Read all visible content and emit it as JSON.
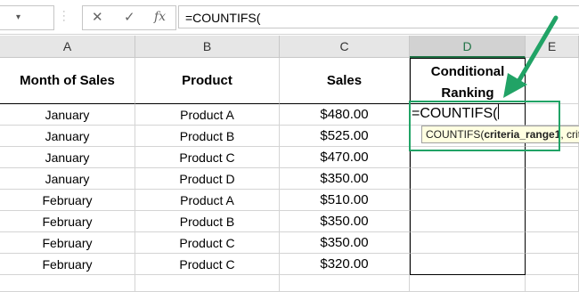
{
  "formula_bar": {
    "namebox_dropdown": "▾",
    "dots": "⋮",
    "cancel": "✕",
    "enter": "✓",
    "fx": "fx",
    "formula": "=COUNTIFS("
  },
  "columns": [
    "A",
    "B",
    "C",
    "D",
    "E"
  ],
  "header_row": {
    "month": "Month of Sales",
    "product": "Product",
    "sales": "Sales",
    "ranking_line1": "Conditional",
    "ranking_line2": "Ranking"
  },
  "rows": [
    {
      "month": "January",
      "product": "Product A",
      "sales": "$480.00"
    },
    {
      "month": "January",
      "product": "Product B",
      "sales": "$525.00"
    },
    {
      "month": "January",
      "product": "Product C",
      "sales": "$470.00"
    },
    {
      "month": "January",
      "product": "Product D",
      "sales": "$350.00"
    },
    {
      "month": "February",
      "product": "Product A",
      "sales": "$510.00"
    },
    {
      "month": "February",
      "product": "Product B",
      "sales": "$350.00"
    },
    {
      "month": "February",
      "product": "Product C",
      "sales": "$350.00"
    },
    {
      "month": "February",
      "product": "Product C",
      "sales": "$320.00"
    }
  ],
  "editing_cell": {
    "text": "=COUNTIFS("
  },
  "tooltip": {
    "fn": "COUNTIFS(",
    "arg1": "criteria_range1",
    "rest": ", crite"
  },
  "colors": {
    "accent_green": "#21a366",
    "tooltip_bg": "#ffffe1"
  }
}
